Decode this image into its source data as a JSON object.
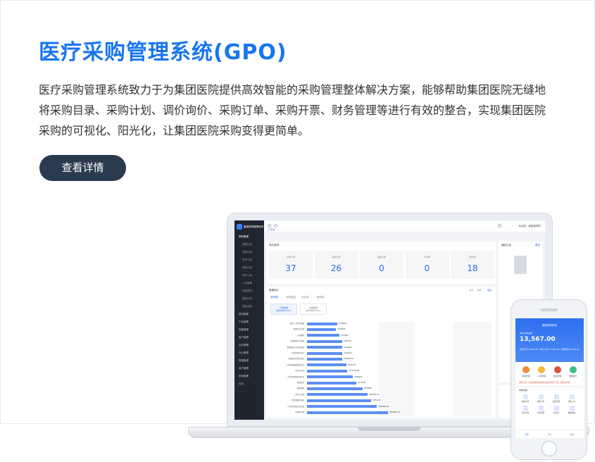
{
  "hero": {
    "title": "医疗采购管理系统(GPO)",
    "description_lines": [
      "医疗采购管理系统致力于为集团医院提供高效智能的采购管理整体解决方案，能够帮助集团医院无缝地",
      "将采购目录、采购计划、调价询价、采购订单、采购开票、财务管理等进行有效的整合，实现集团医院",
      "采购的可视化、阳光化，让集团医院采购变得更简单。"
    ],
    "detail_button": "查看详情"
  },
  "laptop": {
    "sidebar": {
      "logo": "集团采购管理系统",
      "items": [
        {
          "label": "采购管理",
          "active": true,
          "sub": false
        },
        {
          "label": "采购计划",
          "active": false,
          "sub": true
        },
        {
          "label": "采购订单",
          "active": false,
          "sub": true
        },
        {
          "label": "发货订单",
          "active": false,
          "sub": true
        },
        {
          "label": "验收记录",
          "active": false,
          "sub": true
        },
        {
          "label": "采购入库",
          "active": false,
          "sub": true
        },
        {
          "label": "入库管理",
          "active": false,
          "sub": true
        },
        {
          "label": "采购退货",
          "active": false,
          "sub": true
        },
        {
          "label": "直购补货",
          "active": false,
          "sub": true
        },
        {
          "label": "物品追溯",
          "active": false,
          "sub": true
        },
        {
          "label": "财务管理",
          "active": false,
          "sub": false
        },
        {
          "label": "产品管理",
          "active": false,
          "sub": false
        },
        {
          "label": "设备管理",
          "active": false,
          "sub": false
        },
        {
          "label": "客户管理",
          "active": false,
          "sub": false
        },
        {
          "label": "合作管理",
          "active": false,
          "sub": false
        },
        {
          "label": "办公管理",
          "active": false,
          "sub": false
        },
        {
          "label": "数据管理",
          "active": false,
          "sub": false
        },
        {
          "label": "用户管理",
          "active": false,
          "sub": false
        },
        {
          "label": "系统管理",
          "active": false,
          "sub": false
        },
        {
          "label": "日志",
          "active": false,
          "sub": false
        }
      ]
    },
    "topbar": {
      "tab": "工作台",
      "user": "欢迎您，超级管理员"
    },
    "todo": {
      "title": "待办事项",
      "stats": [
        {
          "label": "采购计划",
          "value": "37"
        },
        {
          "label": "采购订单",
          "value": "26"
        },
        {
          "label": "验收记录",
          "value": "0"
        },
        {
          "label": "付款单",
          "value": "0"
        },
        {
          "label": "预付款",
          "value": "18"
        }
      ]
    },
    "notice": {
      "title": "通知公告",
      "more": "更多"
    },
    "data_panel": {
      "title": "数据统计",
      "range_labels": [
        "本月",
        "本年",
        "更多"
      ],
      "tabs": [
        "采购额",
        "采购数量",
        "供应商",
        "物资类"
      ],
      "chips": [
        {
          "line1": "订单金额",
          "line2": "统计时间:2021"
        },
        {
          "line1": "采购数量",
          "line2": "统计时间:2021"
        }
      ]
    },
    "bar_chart": {
      "rows": [
        {
          "label": "医用一次性注射器",
          "value": "1295624"
        },
        {
          "label": "医用外科口罩",
          "value": "1243596"
        },
        {
          "label": "心电图纸",
          "value": "1375603"
        },
        {
          "label": "医用留置针(单翼)",
          "value": "1491709"
        },
        {
          "label": "静脉输液针(带过滤器)",
          "value": "1513060"
        },
        {
          "label": "一次性使用采血针",
          "value": "1515472"
        },
        {
          "label": "医用检查手套(无粉)",
          "value": "1503644.6"
        },
        {
          "label": "一次性输液器(精密过滤)",
          "value": "1679152"
        },
        {
          "label": "医用纱布块",
          "value": "1717175.28"
        },
        {
          "label": "一次性使用无菌导尿包",
          "value": "1968152"
        },
        {
          "label": "医用胶带",
          "value": "2112030"
        },
        {
          "label": "医用棉签",
          "value": "2374803"
        },
        {
          "label": "一次性引流袋",
          "value": "2603503.8"
        },
        {
          "label": "医用酒精消毒液",
          "value": "2751972"
        },
        {
          "label": "一次性使用真空采血管",
          "value": "2992444.94"
        },
        {
          "label": "医用防护服",
          "value": "3462897.72"
        }
      ]
    }
  },
  "phone": {
    "title": "集团采购系统",
    "amount_label": "本年采购总额",
    "amount": "13,567.00",
    "stats": [
      "本月订单 23,806.00",
      "本月入库 371,806.00",
      "本月结算 86,586.00"
    ],
    "icons": [
      "采购管理",
      "入库管理",
      "结算管理",
      "数据统计"
    ],
    "icon_colors": [
      "#f08a3a",
      "#f0b93a",
      "#e0503d",
      "#3ac089"
    ],
    "notice": "通知公告：集团采购系统本月采购计划已下发，请及时查看",
    "section": "常用功能",
    "grid": [
      "采购计划",
      "采购订单",
      "发货管理",
      "采购入库",
      "库存查询",
      "付款管理",
      "供应商",
      "数据报表"
    ],
    "tabbar": [
      "首页",
      "消息",
      "我的"
    ]
  },
  "colors": {
    "accent": "#1976f0",
    "button": "#2b3a4e",
    "bar": "#5b8ff0"
  }
}
